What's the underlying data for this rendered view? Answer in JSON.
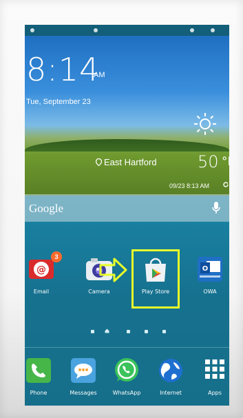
{
  "lockscreen": {
    "time": "8:14",
    "ampm": "AM",
    "date": "Tue, September 23",
    "location": "East Hartford",
    "temperature": "50",
    "temp_unit": "°F",
    "updated": "09/23 8:13 AM"
  },
  "search": {
    "label": "Google"
  },
  "home_apps": [
    {
      "label": "Email",
      "badge": "3"
    },
    {
      "label": "Camera"
    },
    {
      "label": "Play Store"
    },
    {
      "label": "OWA"
    }
  ],
  "dock_apps": [
    {
      "label": "Phone"
    },
    {
      "label": "Messages"
    },
    {
      "label": "WhatsApp"
    },
    {
      "label": "Internet"
    },
    {
      "label": "Apps"
    }
  ],
  "colors": {
    "highlight": "#e8ff2a",
    "badge": "#ff6a2d",
    "play_store_bag": "#eef2f5"
  },
  "icons": {
    "sun": "sun-icon",
    "pin": "location-pin-icon",
    "refresh": "refresh-icon",
    "mic": "mic-icon",
    "arrow": "arrow-right-icon"
  }
}
